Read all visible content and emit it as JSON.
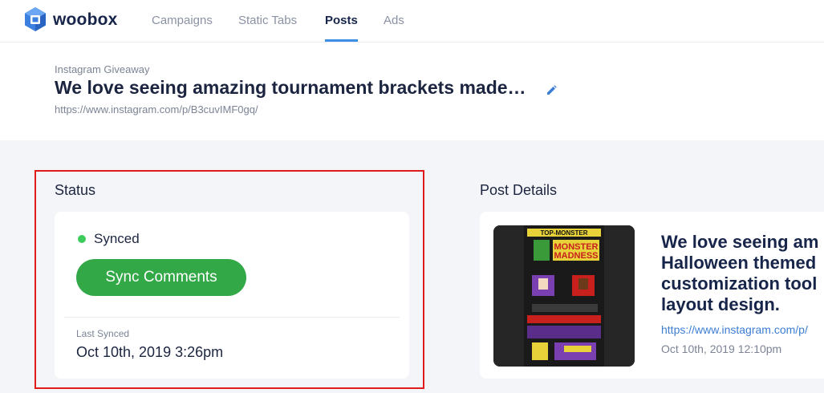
{
  "nav": {
    "brand": "woobox",
    "items": [
      {
        "label": "Campaigns"
      },
      {
        "label": "Static Tabs"
      },
      {
        "label": "Posts",
        "active": true
      },
      {
        "label": "Ads"
      }
    ]
  },
  "post": {
    "type": "Instagram Giveaway",
    "title": "We love seeing amazing tournament brackets made…",
    "url": "https://www.instagram.com/p/B3cuvIMF0gq/"
  },
  "status": {
    "heading": "Status",
    "state": "Synced",
    "sync_button": "Sync Comments",
    "last_synced_label": "Last Synced",
    "last_synced_value": "Oct 10th, 2019 3:26pm"
  },
  "details": {
    "heading": "Post Details",
    "caption": "We love seeing am Halloween themed customization tool layout design.",
    "url": "https://www.instagram.com/p/",
    "date": "Oct 10th, 2019 12:10pm",
    "thumb_text": {
      "top": "TOP-MONSTER",
      "title1": "MONSTER",
      "title2": "MADNESS"
    }
  },
  "colors": {
    "accent": "#3d8fe6",
    "button": "#32a846",
    "status_dot": "#3ccc5c",
    "highlight": "#e01b1b",
    "link": "#3d7ed4"
  },
  "icons": {
    "logo": "woobox-cube-icon",
    "edit": "pencil-icon"
  }
}
